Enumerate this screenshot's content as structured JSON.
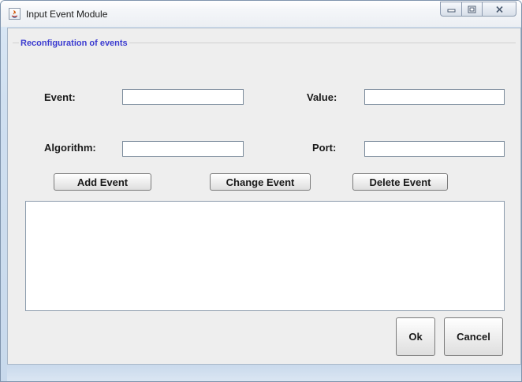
{
  "window": {
    "title": "Input Event Module",
    "controls": {
      "minimize_icon": "minimize-icon",
      "maximize_icon": "maximize-icon",
      "close_icon": "close-icon"
    }
  },
  "group": {
    "title": "Reconfiguration of events"
  },
  "form": {
    "event_label": "Event:",
    "event_value": "",
    "value_label": "Value:",
    "value_value": "",
    "algorithm_label": "Algorithm:",
    "algorithm_value": "",
    "port_label": "Port:",
    "port_value": ""
  },
  "actions": {
    "add_label": "Add Event",
    "change_label": "Change Event",
    "delete_label": "Delete Event"
  },
  "events_list": {
    "content": ""
  },
  "dialog_buttons": {
    "ok_label": "Ok",
    "cancel_label": "Cancel"
  },
  "colors": {
    "group_title": "#3b3bd0",
    "panel_background": "#eeeeee",
    "window_frame": "#cfdff0"
  }
}
